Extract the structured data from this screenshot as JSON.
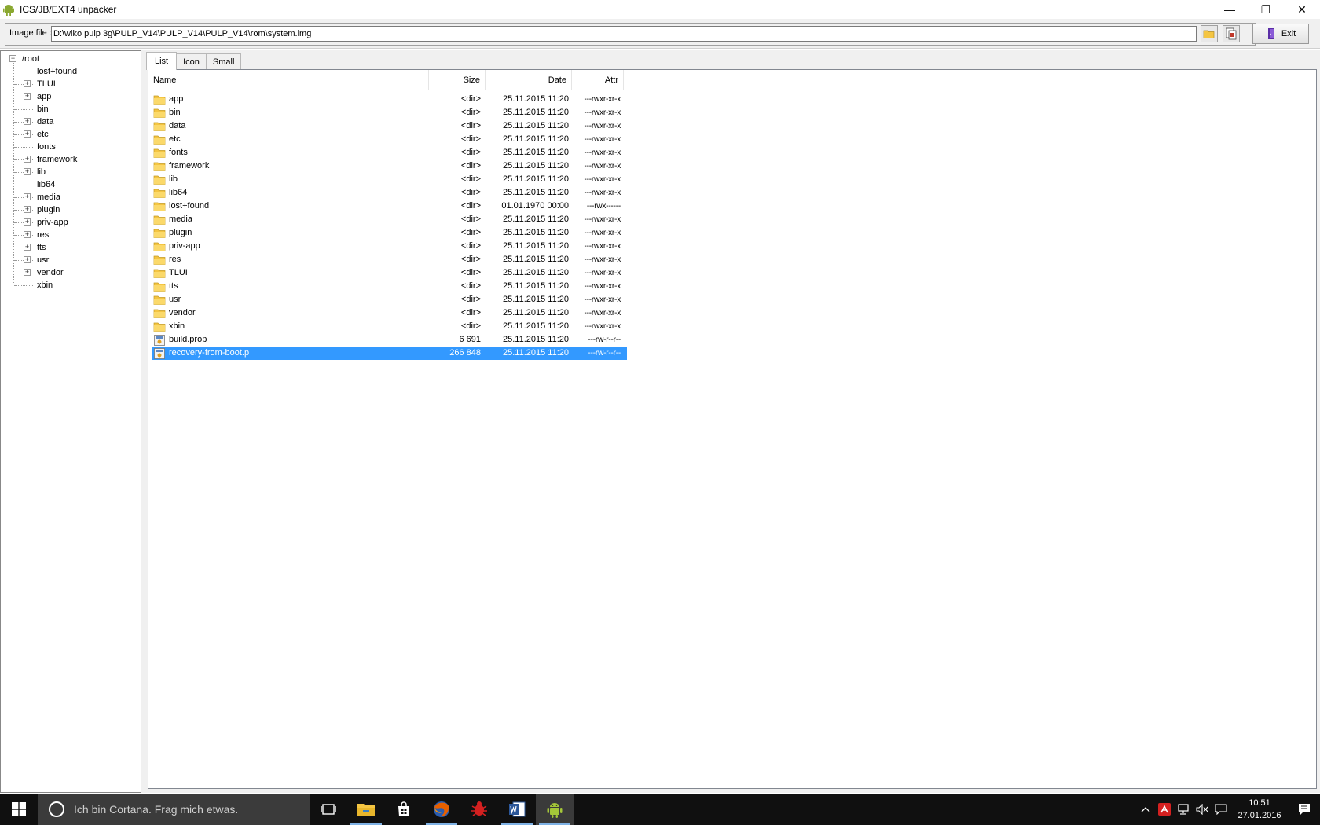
{
  "window": {
    "title": "ICS/JB/EXT4 unpacker",
    "minimize_glyph": "—",
    "restore_glyph": "❐",
    "close_glyph": "✕"
  },
  "pathbar": {
    "label": "Image file :",
    "path_value": "D:\\wiko pulp 3g\\PULP_V14\\PULP_V14\\PULP_V14\\rom\\system.img",
    "exit_label": "Exit"
  },
  "tree": {
    "root": "/root",
    "items": [
      {
        "label": "lost+found",
        "expandable": false
      },
      {
        "label": "TLUI",
        "expandable": true
      },
      {
        "label": "app",
        "expandable": true
      },
      {
        "label": "bin",
        "expandable": false
      },
      {
        "label": "data",
        "expandable": true
      },
      {
        "label": "etc",
        "expandable": true
      },
      {
        "label": "fonts",
        "expandable": false
      },
      {
        "label": "framework",
        "expandable": true
      },
      {
        "label": "lib",
        "expandable": true
      },
      {
        "label": "lib64",
        "expandable": false
      },
      {
        "label": "media",
        "expandable": true
      },
      {
        "label": "plugin",
        "expandable": true
      },
      {
        "label": "priv-app",
        "expandable": true
      },
      {
        "label": "res",
        "expandable": true
      },
      {
        "label": "tts",
        "expandable": true
      },
      {
        "label": "usr",
        "expandable": true
      },
      {
        "label": "vendor",
        "expandable": true
      },
      {
        "label": "xbin",
        "expandable": false
      }
    ]
  },
  "tabs": [
    {
      "label": "List",
      "active": true
    },
    {
      "label": "Icon",
      "active": false
    },
    {
      "label": "Small",
      "active": false
    }
  ],
  "columns": {
    "name": "Name",
    "size": "Size",
    "date": "Date",
    "attr": "Attr"
  },
  "files": [
    {
      "name": "app",
      "size": "<dir>",
      "date": "25.11.2015 11:20",
      "attr": "---rwxr-xr-x",
      "type": "folder"
    },
    {
      "name": "bin",
      "size": "<dir>",
      "date": "25.11.2015 11:20",
      "attr": "---rwxr-xr-x",
      "type": "folder"
    },
    {
      "name": "data",
      "size": "<dir>",
      "date": "25.11.2015 11:20",
      "attr": "---rwxr-xr-x",
      "type": "folder"
    },
    {
      "name": "etc",
      "size": "<dir>",
      "date": "25.11.2015 11:20",
      "attr": "---rwxr-xr-x",
      "type": "folder"
    },
    {
      "name": "fonts",
      "size": "<dir>",
      "date": "25.11.2015 11:20",
      "attr": "---rwxr-xr-x",
      "type": "folder"
    },
    {
      "name": "framework",
      "size": "<dir>",
      "date": "25.11.2015 11:20",
      "attr": "---rwxr-xr-x",
      "type": "folder"
    },
    {
      "name": "lib",
      "size": "<dir>",
      "date": "25.11.2015 11:20",
      "attr": "---rwxr-xr-x",
      "type": "folder"
    },
    {
      "name": "lib64",
      "size": "<dir>",
      "date": "25.11.2015 11:20",
      "attr": "---rwxr-xr-x",
      "type": "folder"
    },
    {
      "name": "lost+found",
      "size": "<dir>",
      "date": "01.01.1970 00:00",
      "attr": "---rwx------",
      "type": "folder"
    },
    {
      "name": "media",
      "size": "<dir>",
      "date": "25.11.2015 11:20",
      "attr": "---rwxr-xr-x",
      "type": "folder"
    },
    {
      "name": "plugin",
      "size": "<dir>",
      "date": "25.11.2015 11:20",
      "attr": "---rwxr-xr-x",
      "type": "folder"
    },
    {
      "name": "priv-app",
      "size": "<dir>",
      "date": "25.11.2015 11:20",
      "attr": "---rwxr-xr-x",
      "type": "folder"
    },
    {
      "name": "res",
      "size": "<dir>",
      "date": "25.11.2015 11:20",
      "attr": "---rwxr-xr-x",
      "type": "folder"
    },
    {
      "name": "TLUI",
      "size": "<dir>",
      "date": "25.11.2015 11:20",
      "attr": "---rwxr-xr-x",
      "type": "folder"
    },
    {
      "name": "tts",
      "size": "<dir>",
      "date": "25.11.2015 11:20",
      "attr": "---rwxr-xr-x",
      "type": "folder"
    },
    {
      "name": "usr",
      "size": "<dir>",
      "date": "25.11.2015 11:20",
      "attr": "---rwxr-xr-x",
      "type": "folder"
    },
    {
      "name": "vendor",
      "size": "<dir>",
      "date": "25.11.2015 11:20",
      "attr": "---rwxr-xr-x",
      "type": "folder"
    },
    {
      "name": "xbin",
      "size": "<dir>",
      "date": "25.11.2015 11:20",
      "attr": "---rwxr-xr-x",
      "type": "folder"
    },
    {
      "name": "build.prop",
      "size": "6 691",
      "date": "25.11.2015 11:20",
      "attr": "---rw-r--r--",
      "type": "file"
    },
    {
      "name": "recovery-from-boot.p",
      "size": "266 848",
      "date": "25.11.2015 11:20",
      "attr": "---rw-r--r--",
      "type": "file",
      "selected": true
    }
  ],
  "taskbar": {
    "search_placeholder": "Ich bin Cortana. Frag mich etwas.",
    "time": "10:51",
    "date": "27.01.2016",
    "apps": [
      "task-view-icon",
      "file-explorer-icon",
      "store-icon",
      "firefox-icon",
      "bug-tool-icon",
      "word-icon",
      "android-icon"
    ]
  },
  "colors": {
    "selection": "#3399ff",
    "folder": "#f4c542",
    "taskbar": "#101010",
    "android_green": "#a4c639"
  }
}
